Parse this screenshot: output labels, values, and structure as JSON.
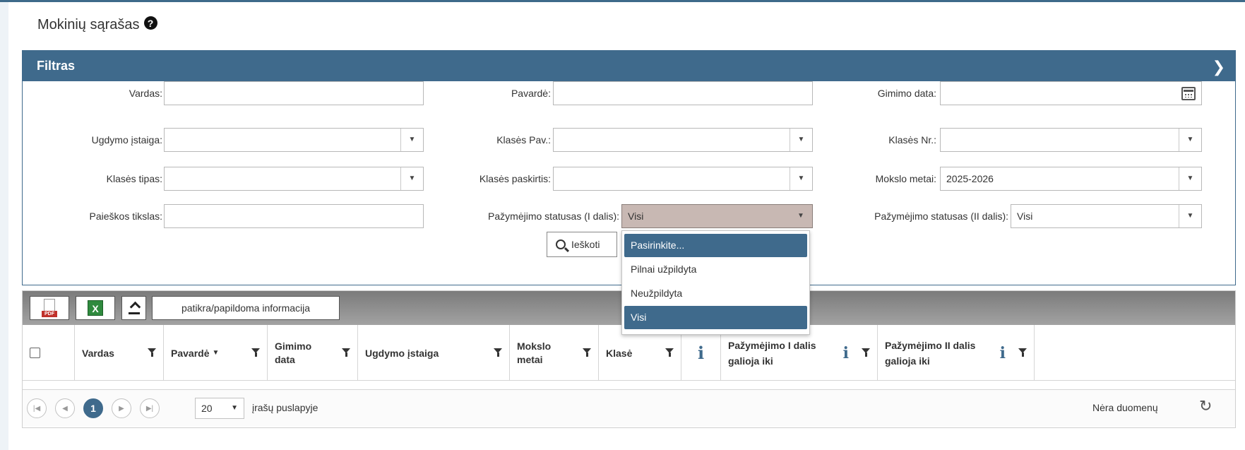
{
  "page": {
    "title": "Mokinių sąrašas",
    "help_icon": "?"
  },
  "filter": {
    "header": "Filtras",
    "chevron": "❯",
    "fields": {
      "vardas_label": "Vardas:",
      "pavarde_label": "Pavardė:",
      "gimimo_data_label": "Gimimo data:",
      "ugdymo_istaiga_label": "Ugdymo įstaiga:",
      "klases_pav_label": "Klasės Pav.:",
      "klases_nr_label": "Klasės Nr.:",
      "klases_tipas_label": "Klasės tipas:",
      "klases_paskirtis_label": "Klasės paskirtis:",
      "mokslo_metai_label": "Mokslo metai:",
      "mokslo_metai_value": "2025-2026",
      "paieskos_tikslas_label": "Paieškos tikslas:",
      "pazymejimo_1_label": "Pažymėjimo statusas (I dalis):",
      "pazymejimo_1_value": "Visi",
      "pazymejimo_2_label": "Pažymėjimo statusas (II dalis):",
      "pazymejimo_2_value": "Visi"
    },
    "search_button": "Ieškoti",
    "dropdown_options": [
      "Pasirinkite...",
      "Pilnai užpildyta",
      "Neužpildyta",
      "Visi"
    ]
  },
  "grid": {
    "toolbar": {
      "pdf_icon": "pdf-icon",
      "excel_icon": "excel-icon",
      "upload_icon": "upload-icon",
      "info_button": "patikra/papildoma informacija"
    },
    "columns": {
      "vardas": "Vardas",
      "pavarde": "Pavardė",
      "gimimo_data": "Gimimo data",
      "ugdymo_istaiga": "Ugdymo įstaiga",
      "mokslo_metai": "Mokslo metai",
      "klase": "Klasė",
      "info": "i",
      "paz_1": "Pažymėjimo I dalis galioja iki",
      "paz_2": "Pažymėjimo II dalis galioja iki"
    },
    "pager": {
      "current_page": "1",
      "page_size": "20",
      "page_size_label": "įrašų puslapyje",
      "status": "Nėra duomenų"
    }
  },
  "colors": {
    "accent": "#3f6a8c",
    "selected_select_bg": "#c8b8b3"
  }
}
